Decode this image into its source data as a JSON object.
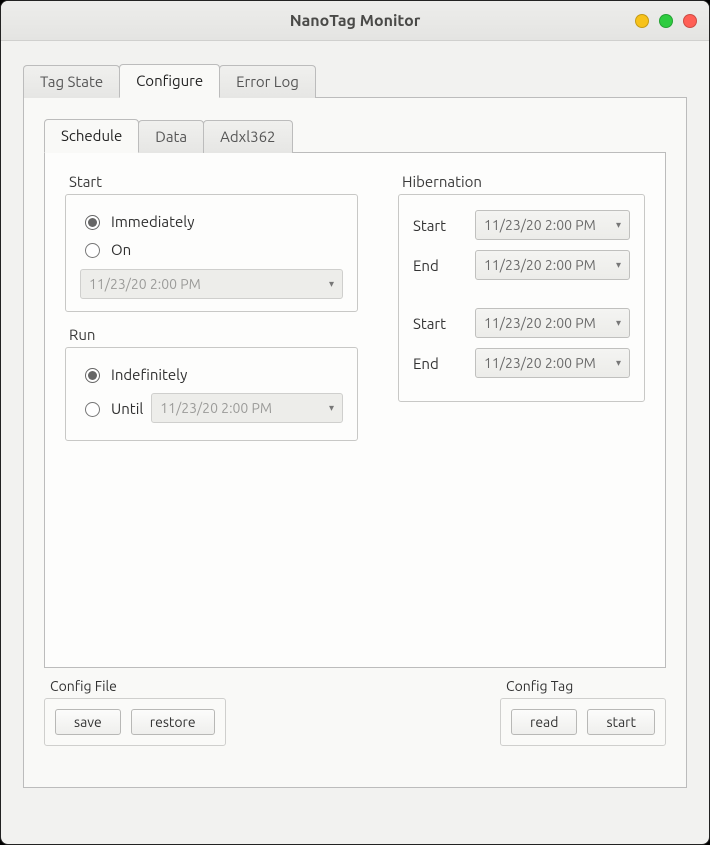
{
  "window": {
    "title": "NanoTag Monitor"
  },
  "top_tabs": {
    "tag_state": "Tag State",
    "configure": "Configure",
    "error_log": "Error Log"
  },
  "inner_tabs": {
    "schedule": "Schedule",
    "data_tab": "Data",
    "adxl": "Adxl362"
  },
  "start_group": {
    "label": "Start",
    "opt_immediately": "Immediately",
    "opt_on": "On",
    "on_datetime": "11/23/20 2:00 PM"
  },
  "run_group": {
    "label": "Run",
    "opt_indef": "Indefinitely",
    "opt_until": "Until",
    "until_datetime": "11/23/20 2:00 PM"
  },
  "hibernation": {
    "label": "Hibernation",
    "row1_start_lbl": "Start",
    "row1_start_dt": "11/23/20 2:00 PM",
    "row1_end_lbl": "End",
    "row1_end_dt": "11/23/20 2:00 PM",
    "row2_start_lbl": "Start",
    "row2_start_dt": "11/23/20 2:00 PM",
    "row2_end_lbl": "End",
    "row2_end_dt": "11/23/20 2:00 PM"
  },
  "config_file": {
    "label": "Config File",
    "save": "save",
    "restore": "restore"
  },
  "config_tag": {
    "label": "Config Tag",
    "read": "read",
    "start": "start"
  }
}
